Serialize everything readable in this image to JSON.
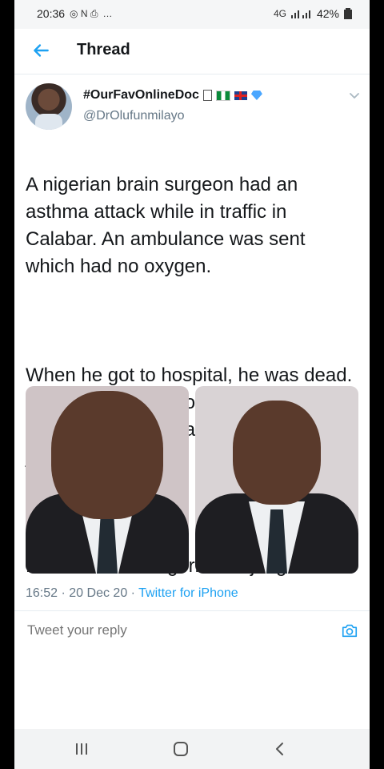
{
  "status": {
    "time": "20:36",
    "left_icons": "◎ N ⎙",
    "overflow": "…",
    "network": "4G",
    "battery": "42%"
  },
  "header": {
    "title": "Thread"
  },
  "tweet": {
    "name": "#OurFavOnlineDoc",
    "handle": "@DrOlufunmilayo",
    "paragraphs": [
      "A nigerian brain surgeon had an asthma attack while in traffic in Calabar. An ambulance was sent which had no oxygen.",
      "When he got to hospital, he was dead. This is a medical doctor. A brain surgeon. His wife- a gynaecologist- just had twins.",
      "RIP Dr Nnadi. Nigeria is a jungle."
    ],
    "time": "16:52",
    "date": "20 Dec 20",
    "source": "Twitter for iPhone"
  },
  "reply": {
    "placeholder": "Tweet your reply"
  },
  "colors": {
    "accent": "#1da1f2",
    "muted": "#657786",
    "text": "#14171a"
  }
}
